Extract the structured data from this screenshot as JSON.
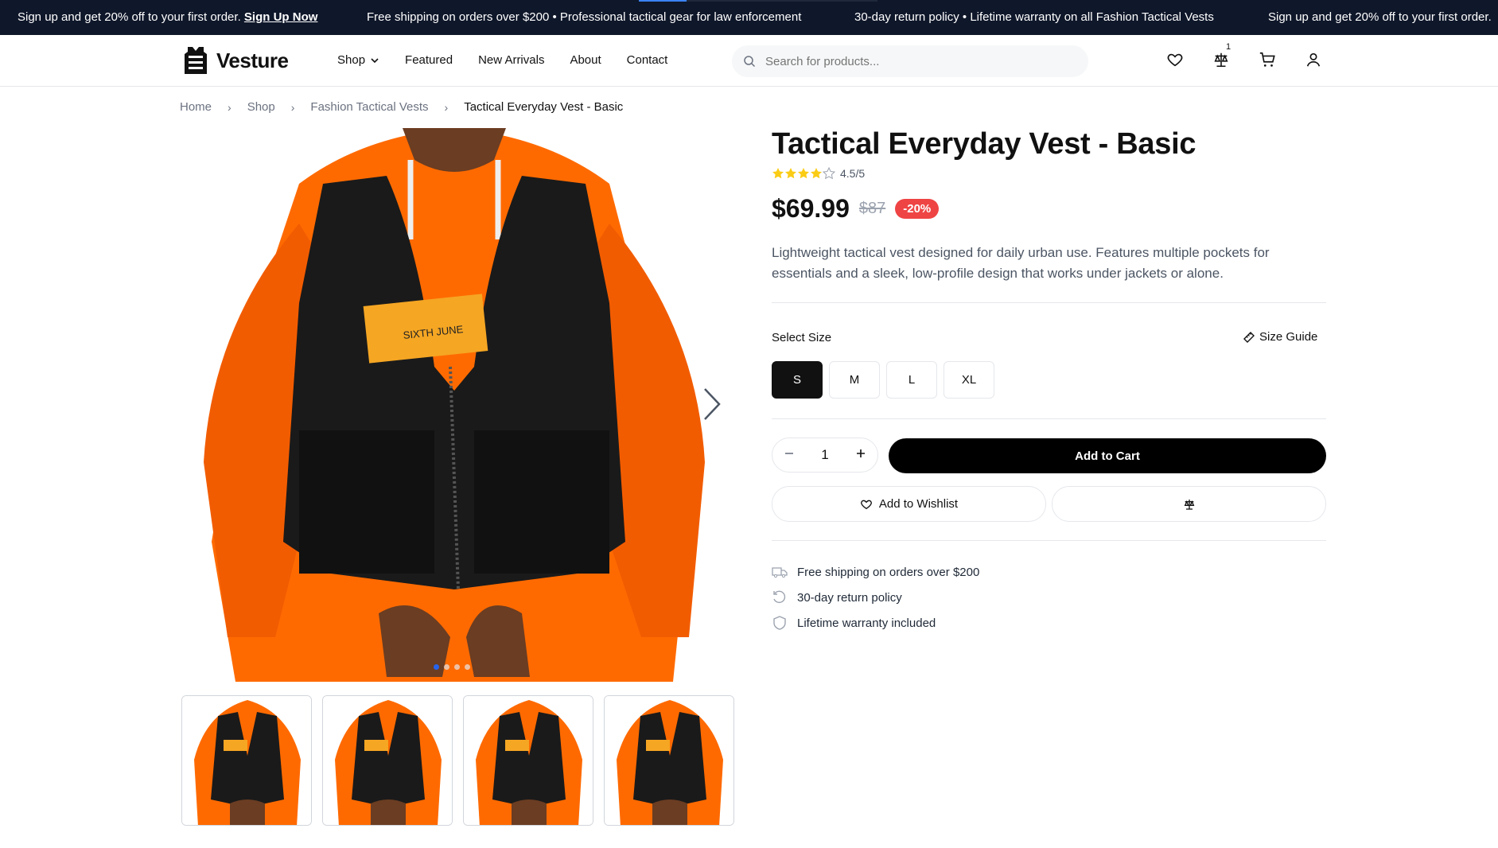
{
  "announcement": {
    "msg1": "Sign up and get 20% off to your first order.",
    "msg1_link": "Sign Up Now",
    "msg2": "Free shipping on orders over $200 • Professional tactical gear for law enforcement",
    "msg3": "30-day return policy • Lifetime warranty on all Fashion Tactical Vests",
    "msg4": "Sign up and get 20% off to your first order."
  },
  "header": {
    "brand": "Vesture",
    "nav": {
      "shop": "Shop",
      "featured": "Featured",
      "new_arrivals": "New Arrivals",
      "about": "About",
      "contact": "Contact"
    },
    "search_placeholder": "Search for products...",
    "compare_count": "1"
  },
  "breadcrumb": {
    "home": "Home",
    "shop": "Shop",
    "category": "Fashion Tactical Vests",
    "current": "Tactical Everyday Vest - Basic"
  },
  "product": {
    "title": "Tactical Everyday Vest - Basic",
    "rating": 4.5,
    "rating_text": "4.5/5",
    "price": "$69.99",
    "old_price": "$87",
    "discount": "-20%",
    "description": "Lightweight tactical vest designed for daily urban use. Features multiple pockets for essentials and a sleek, low-profile design that works under jackets or alone.",
    "select_size_label": "Select Size",
    "size_guide_label": "Size Guide",
    "sizes": [
      "S",
      "M",
      "L",
      "XL"
    ],
    "selected_size": "S",
    "quantity": "1",
    "add_to_cart": "Add to Cart",
    "add_to_wishlist": "Add to Wishlist",
    "features": [
      "Free shipping on orders over $200",
      "30-day return policy",
      "Lifetime warranty included"
    ],
    "image_count": 4,
    "active_image": 1
  },
  "colors": {
    "accent_red": "#ef4444",
    "dark": "#0f172a",
    "vest": "#1a1a1a",
    "hoodie": "#ff6a00",
    "patch": "#f5a623",
    "dot_active": "#2563eb"
  }
}
